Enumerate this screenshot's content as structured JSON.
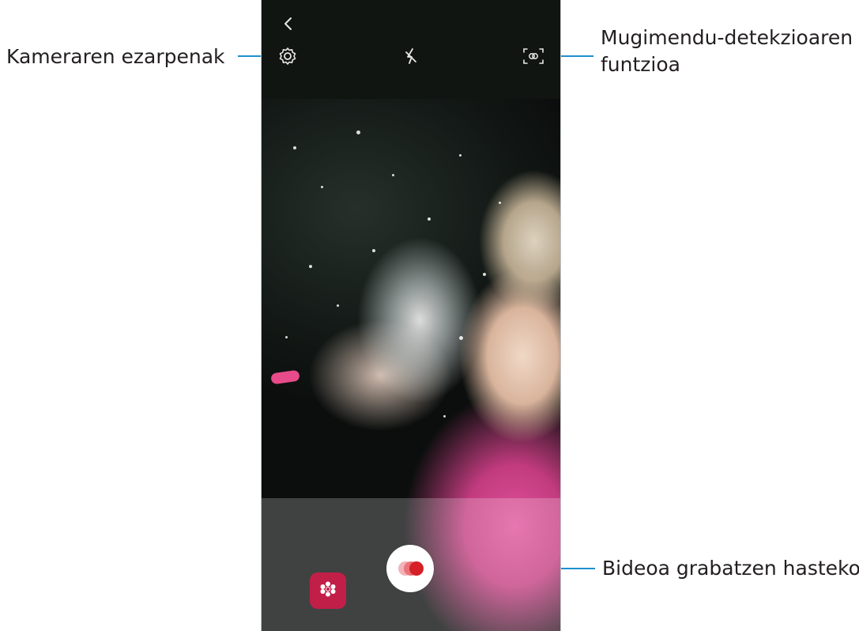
{
  "callouts": {
    "camera_settings": "Kameraren ezarpenak",
    "motion_detection_line1": "Mugimendu-detekzioaren",
    "motion_detection_line2": "funtzioa",
    "start_recording": "Bideoa grabatzen hasteko"
  },
  "icons": {
    "back": "chevron-left-icon",
    "settings": "gear-icon",
    "flash": "flash-off-icon",
    "motion_detection": "motion-detection-icon",
    "gallery": "gallery-icon",
    "record": "super-slow-mo-record-icon"
  },
  "colors": {
    "callout_line": "#1d8fcf",
    "gallery_button": "#c21f48",
    "record_dot": "#d61f26",
    "top_bar": "#101512"
  }
}
